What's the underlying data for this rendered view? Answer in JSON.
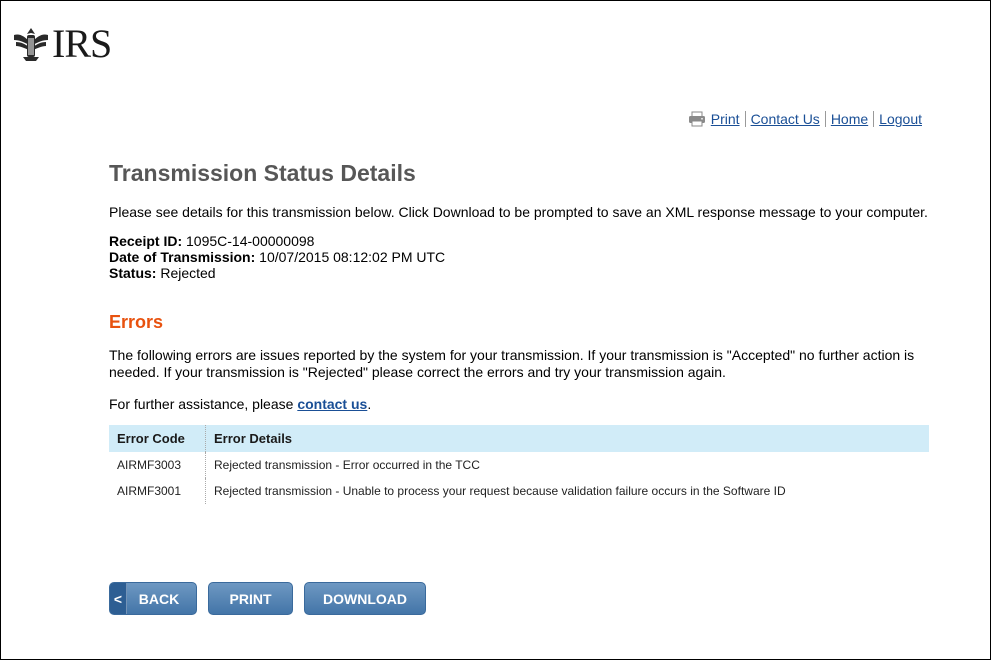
{
  "logo": {
    "text": "IRS"
  },
  "util_nav": {
    "print": "Print",
    "contact": "Contact Us",
    "home": "Home",
    "logout": "Logout"
  },
  "page": {
    "title": "Transmission Status Details",
    "intro": "Please see details for this transmission below. Click Download to be prompted to save an XML response message to your computer."
  },
  "details": {
    "receipt_label": "Receipt ID:",
    "receipt_value": " 1095C-14-00000098",
    "date_label": "Date of Transmission:",
    "date_value": " 10/07/2015 08:12:02 PM UTC",
    "status_label": "Status:",
    "status_value": " Rejected"
  },
  "errors": {
    "heading": "Errors",
    "description": "The following errors are issues reported by the system for your transmission. If your transmission is \"Accepted\" no further action is needed. If your transmission is \"Rejected\" please correct the errors and try your transmission again.",
    "assist_prefix": "For further assistance, please ",
    "assist_link": "contact us",
    "assist_suffix": ".",
    "table": {
      "headers": [
        "Error Code",
        "Error Details"
      ],
      "rows": [
        {
          "code": "AIRMF3003",
          "details": "Rejected transmission - Error occurred in the TCC"
        },
        {
          "code": "AIRMF3001",
          "details": "Rejected transmission - Unable to process your request because validation failure occurs in the Software ID"
        }
      ]
    }
  },
  "buttons": {
    "back": "BACK",
    "back_chevron": "<",
    "print": "PRINT",
    "download": "DOWNLOAD"
  },
  "colors": {
    "link": "#1a4f96",
    "errors_heading": "#e8520f",
    "table_header": "#d1ecf8",
    "button": "#4a7aab"
  }
}
